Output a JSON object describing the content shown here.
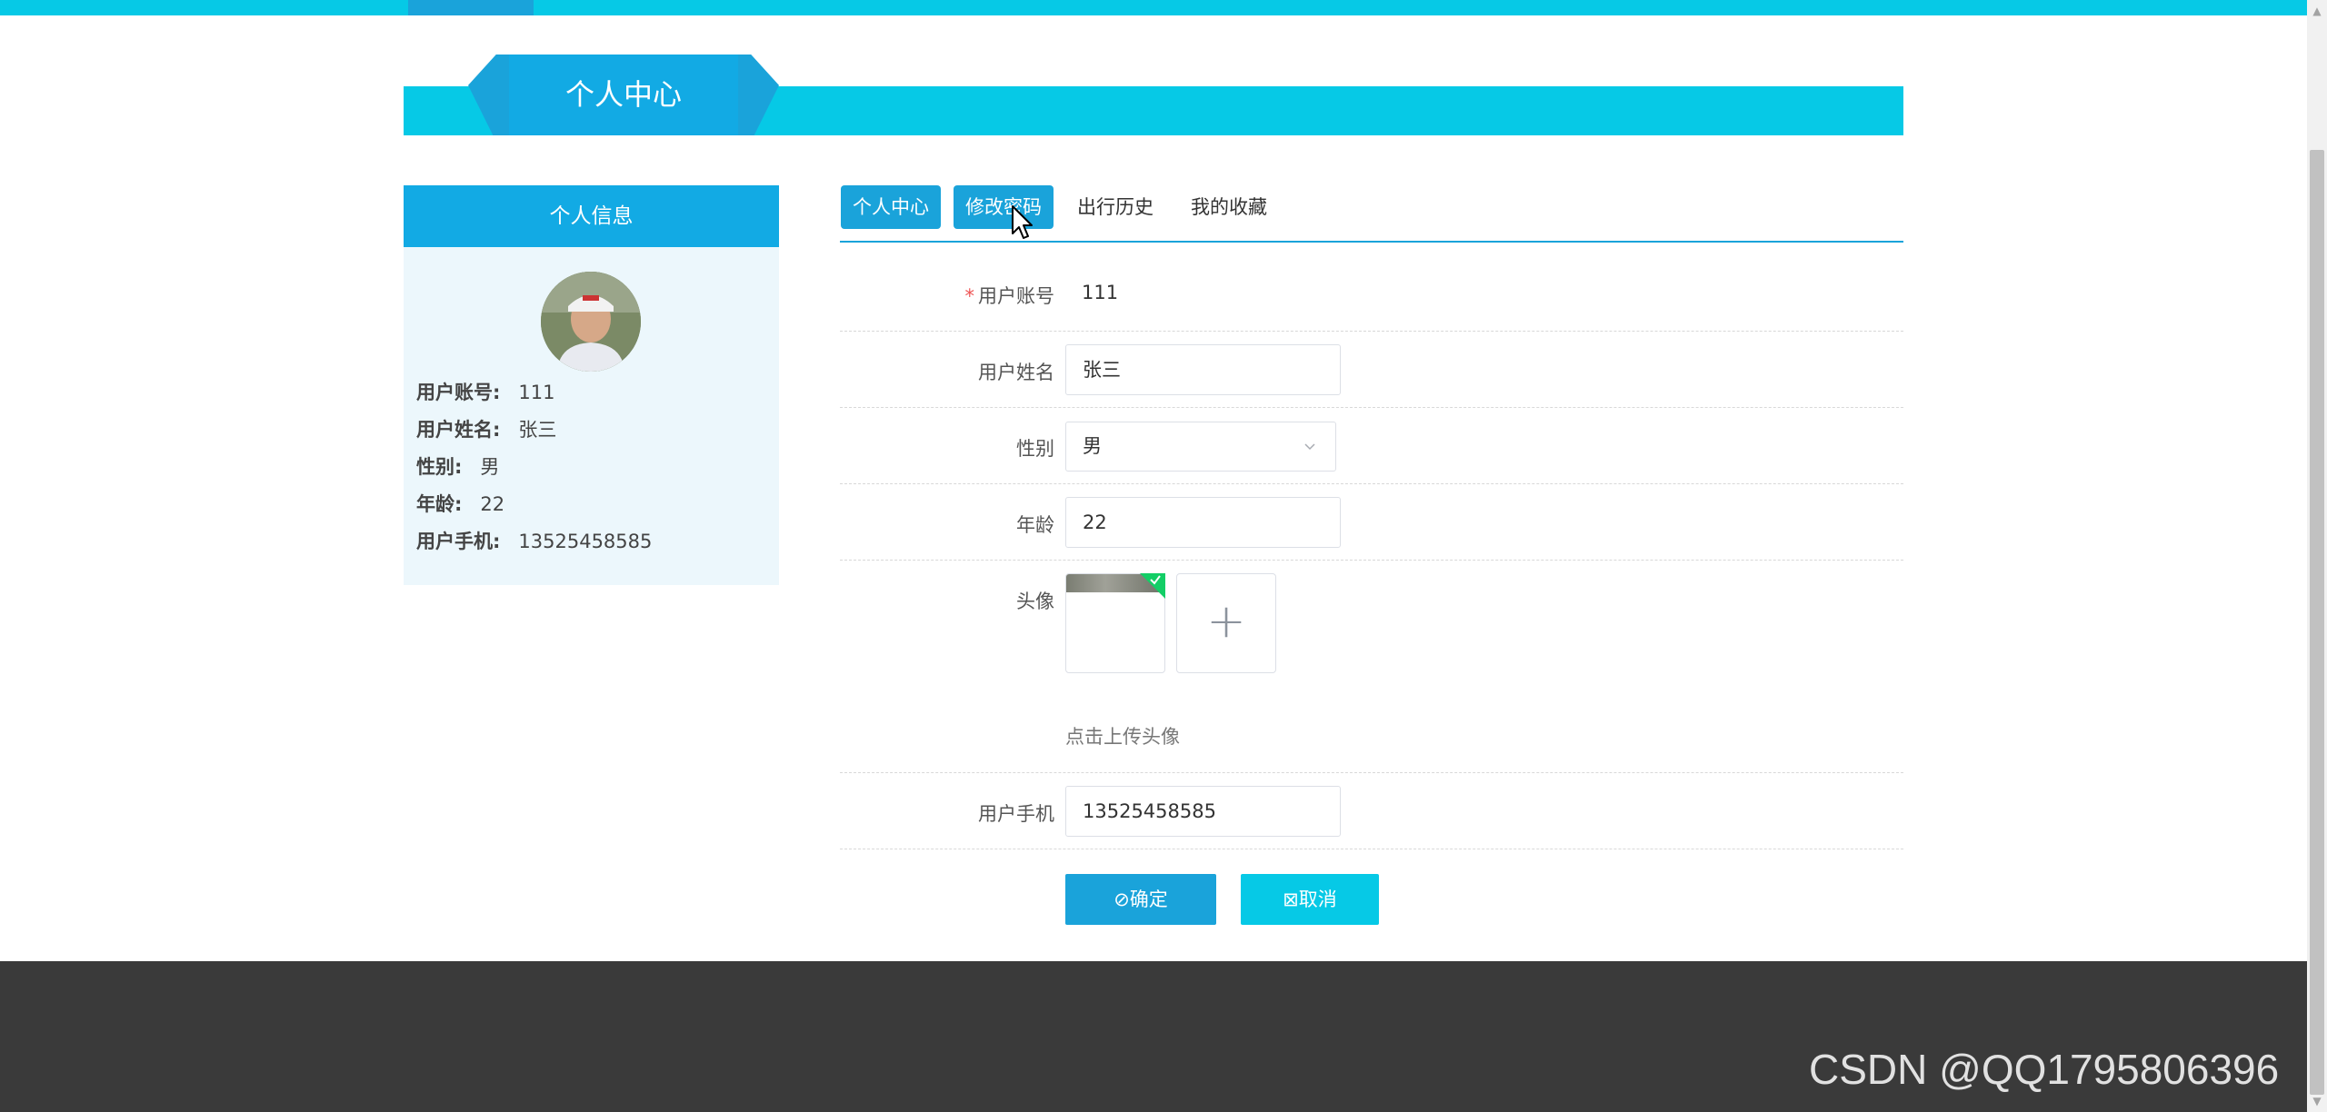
{
  "page": {
    "heading": "个人中心"
  },
  "info_card": {
    "title": "个人信息",
    "fields": [
      {
        "label": "用户账号:",
        "value": "111"
      },
      {
        "label": "用户姓名:",
        "value": "张三"
      },
      {
        "label": "性别:",
        "value": "男"
      },
      {
        "label": "年龄:",
        "value": "22"
      },
      {
        "label": "用户手机:",
        "value": "13525458585"
      }
    ]
  },
  "tabs": [
    {
      "label": "个人中心",
      "active": true
    },
    {
      "label": "修改密码",
      "active": true
    },
    {
      "label": "出行历史",
      "active": false
    },
    {
      "label": "我的收藏",
      "active": false
    }
  ],
  "form": {
    "account": {
      "label": "用户账号",
      "value": "111",
      "required": "*"
    },
    "name": {
      "label": "用户姓名",
      "value": "张三"
    },
    "gender": {
      "label": "性别",
      "value": "男"
    },
    "age": {
      "label": "年龄",
      "value": "22"
    },
    "avatar": {
      "label": "头像",
      "hint": "点击上传头像",
      "add_glyph": "+"
    },
    "phone": {
      "label": "用户手机",
      "value": "13525458585"
    }
  },
  "buttons": {
    "confirm": "⊘确定",
    "cancel": "⊠取消"
  },
  "footer": {
    "watermark": "CSDN @QQ1795806396"
  },
  "colors": {
    "accent_cyan": "#06c9e6",
    "accent_blue": "#1aa3da",
    "footer_bg": "#3a3a3a"
  }
}
